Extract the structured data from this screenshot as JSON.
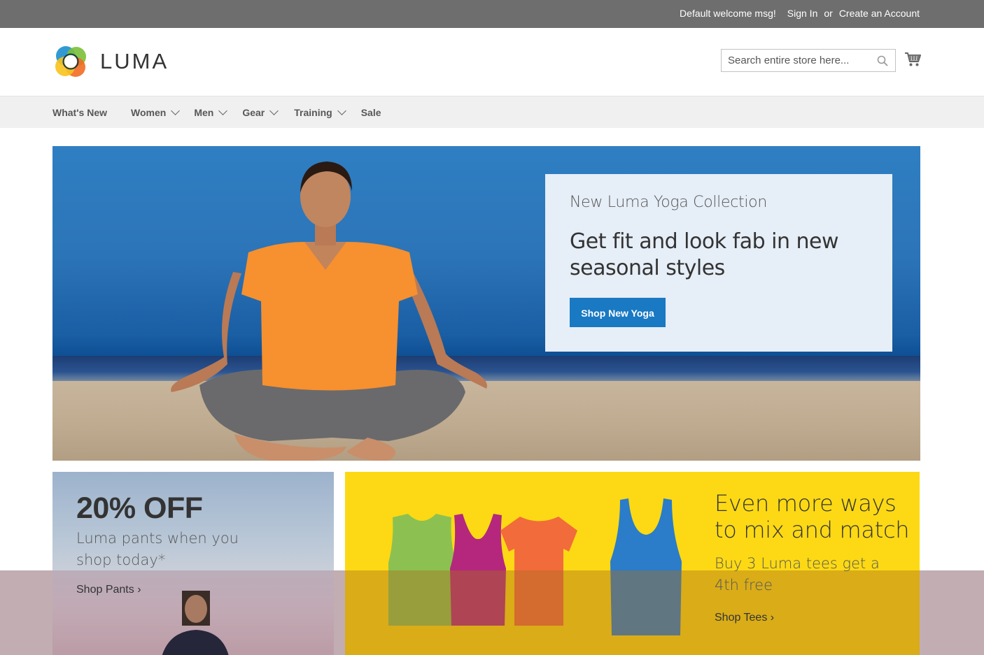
{
  "topbar": {
    "welcome": "Default welcome msg!",
    "sign_in": "Sign In",
    "or": "or",
    "create_account": "Create an Account"
  },
  "header": {
    "logo_text": "LUMA",
    "search_placeholder": "Search entire store here...",
    "icons": [
      "search-icon",
      "cart-icon"
    ]
  },
  "nav": {
    "items": [
      {
        "label": "What's New",
        "has_dropdown": false
      },
      {
        "label": "Women",
        "has_dropdown": true
      },
      {
        "label": "Men",
        "has_dropdown": true
      },
      {
        "label": "Gear",
        "has_dropdown": true
      },
      {
        "label": "Training",
        "has_dropdown": true
      },
      {
        "label": "Sale",
        "has_dropdown": false
      }
    ]
  },
  "hero": {
    "subtitle": "New Luma Yoga Collection",
    "headline": "Get fit and look fab in new seasonal styles",
    "button": "Shop New Yoga"
  },
  "pants_promo": {
    "big": "20% OFF",
    "desc": "Luma pants when you shop today*",
    "link": "Shop Pants"
  },
  "tees_promo": {
    "title": "Even more ways to mix and match",
    "desc": "Buy 3 Luma tees get a 4th free",
    "link": "Shop Tees"
  },
  "colors": {
    "topbar": "#6e6e6e",
    "nav_bg": "#f0f0f0",
    "primary_button": "#1979c3",
    "tees_bg": "#fcd914"
  }
}
